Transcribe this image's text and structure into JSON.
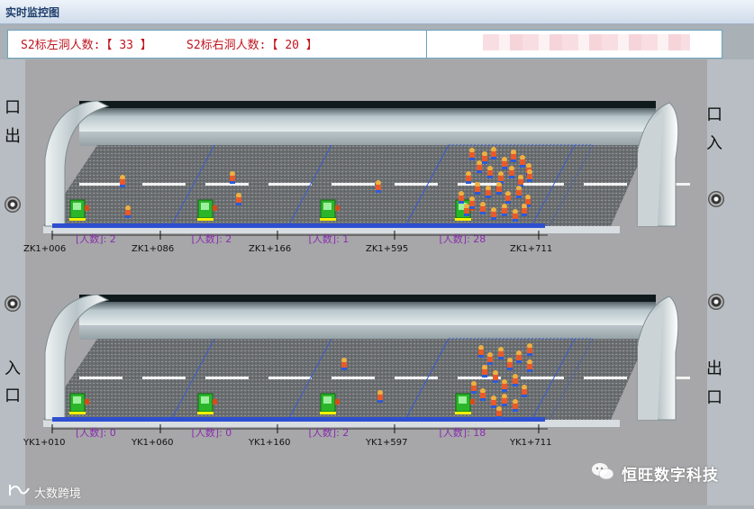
{
  "window": {
    "title": "实时监控图"
  },
  "info": {
    "left_label": "S2标左洞人数:【 ",
    "left_count": "33",
    "left_suffix": " 】",
    "right_label": "S2标右洞人数:【 ",
    "right_count": "20",
    "right_suffix": " 】"
  },
  "side_labels": {
    "left_top": [
      "口",
      "出"
    ],
    "left_bottom": [
      "入",
      "口"
    ],
    "right_top": [
      "口",
      "入"
    ],
    "right_bottom": [
      "出",
      "口"
    ]
  },
  "tunnels": [
    {
      "id": "top",
      "stakes": [
        "ZK1+006",
        "ZK1+086",
        "ZK1+166",
        "ZK1+595",
        "ZK1+711"
      ],
      "segments": [
        {
          "label": "[人数]:",
          "count": "2",
          "workers": 2
        },
        {
          "label": "[人数]:",
          "count": "2",
          "workers": 2
        },
        {
          "label": "[人数]:",
          "count": "1",
          "workers": 1
        },
        {
          "label": "[人数]:",
          "count": "28",
          "workers": 28
        }
      ]
    },
    {
      "id": "bottom",
      "stakes": [
        "YK1+010",
        "YK1+060",
        "YK1+160",
        "YK1+597",
        "YK1+711"
      ],
      "segments": [
        {
          "label": "[人数]:",
          "count": "0",
          "workers": 0
        },
        {
          "label": "[人数]:",
          "count": "0",
          "workers": 0
        },
        {
          "label": "[人数]:",
          "count": "2",
          "workers": 2
        },
        {
          "label": "[人数]:",
          "count": "18",
          "workers": 18
        }
      ]
    }
  ],
  "watermarks": {
    "brand": "恒旺数字科技",
    "source": "大数跨境"
  },
  "icons": [
    "fan-icon",
    "worker-icon",
    "reader-station-icon",
    "wechat-icon"
  ]
}
